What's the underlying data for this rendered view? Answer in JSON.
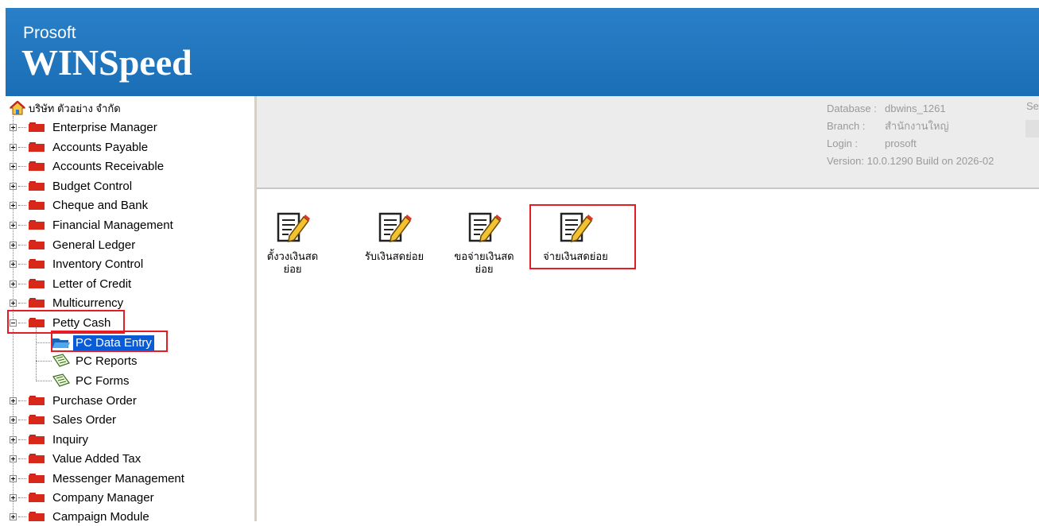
{
  "header": {
    "brand_small": "Prosoft",
    "brand_large": "WINSpeed"
  },
  "sidebar": {
    "root_label": "บริษัท ตัวอย่าง จำกัด",
    "modules": [
      "Enterprise Manager",
      "Accounts Payable",
      "Accounts Receivable",
      "Budget Control",
      "Cheque and Bank",
      "Financial Management",
      "General Ledger",
      "Inventory Control",
      "Letter of Credit",
      "Multicurrency",
      "Petty Cash",
      "Purchase Order",
      "Sales Order",
      "Inquiry",
      "Value Added Tax",
      "Messenger Management",
      "Company Manager",
      "Campaign Module"
    ],
    "petty_cash_children": [
      "PC Data Entry",
      "PC Reports",
      "PC Forms"
    ]
  },
  "info": {
    "database_label": "Database :",
    "database_value": "dbwins_1261",
    "branch_label": "Branch :",
    "branch_value": "สำนักงานใหญ่",
    "login_label": "Login :",
    "login_value": "prosoft",
    "version": "Version: 10.0.1290 Build on 2026-02",
    "extra_label": "Se"
  },
  "icons": [
    {
      "line1": "ตั้งวงเงินสด",
      "line2": "ย่อย"
    },
    {
      "line1": "รับเงินสดย่อย",
      "line2": ""
    },
    {
      "line1": "ขอจ่ายเงินสด",
      "line2": "ย่อย"
    },
    {
      "line1": "จ่ายเงินสดย่อย",
      "line2": ""
    }
  ],
  "colors": {
    "header_blue": "#1f74bd",
    "highlight_red": "#e51c23",
    "folder_red": "#d8281a",
    "selected_bg": "#0a5cd6"
  }
}
